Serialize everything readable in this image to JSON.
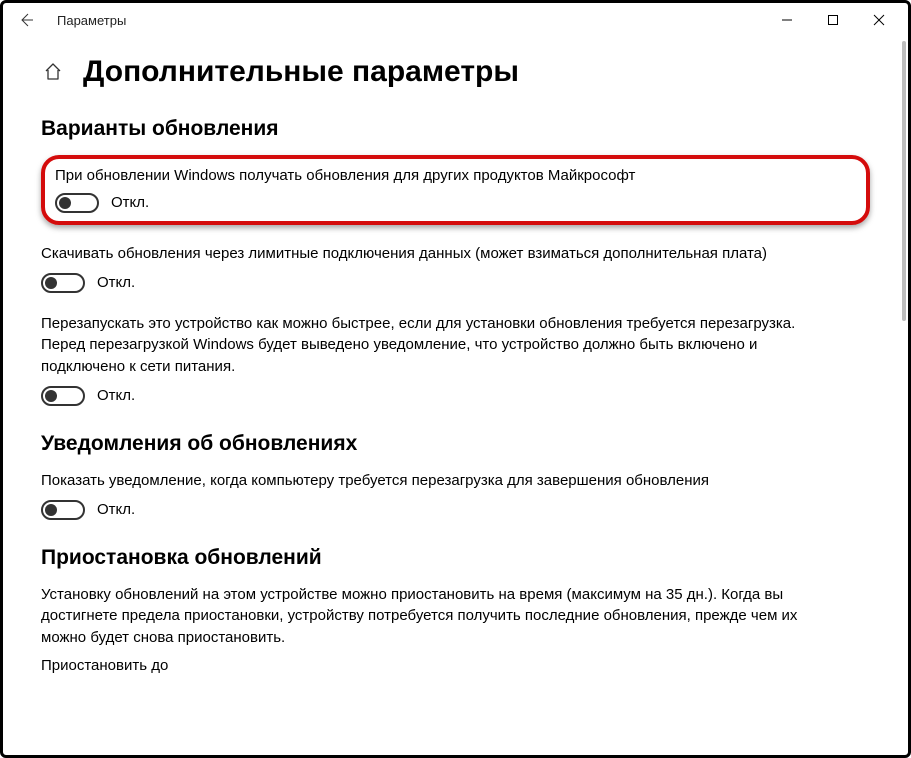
{
  "window_title": "Параметры",
  "page_title": "Дополнительные параметры",
  "toggle_off_label": "Откл.",
  "sections": {
    "update_options": {
      "title": "Варианты обновления",
      "items": [
        "При обновлении Windows получать обновления для других продуктов Майкрософт",
        "Скачивать обновления через лимитные подключения данных (может взиматься дополнительная плата)",
        "Перезапускать это устройство как можно быстрее, если для установки обновления требуется перезагрузка. Перед перезагрузкой Windows будет выведено уведомление, что устройство должно быть включено и подключено к сети питания."
      ]
    },
    "notifications": {
      "title": "Уведомления об обновлениях",
      "items": [
        "Показать уведомление, когда компьютеру требуется перезагрузка для завершения обновления"
      ]
    },
    "pause": {
      "title": "Приостановка обновлений",
      "description": "Установку обновлений на этом устройстве можно приостановить на время (максимум на 35 дн.). Когда вы достигнете предела приостановки, устройству потребуется получить последние обновления, прежде чем их можно будет снова приостановить.",
      "field_label": "Приостановить до"
    }
  }
}
